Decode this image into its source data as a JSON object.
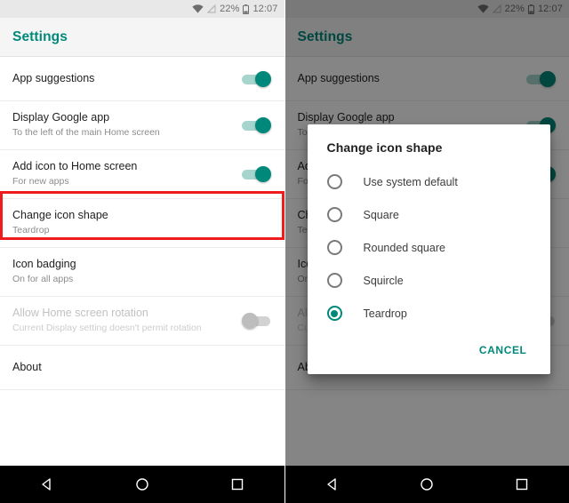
{
  "status_bar": {
    "wifi_icon": "wifi-icon",
    "signal_icon": "signal-off-icon",
    "battery_percent": "22%",
    "battery_icon": "battery-icon",
    "time": "12:07"
  },
  "app_bar": {
    "title": "Settings"
  },
  "colors": {
    "accent": "#00897b",
    "highlight": "#ee1c1c",
    "track_on": "#a6d5ce",
    "track_off": "#d2d2d2"
  },
  "settings_rows": [
    {
      "title": "App suggestions",
      "subtitle": "",
      "control": "toggle",
      "toggle_state": "on",
      "disabled": false,
      "highlighted": false
    },
    {
      "title": "Display Google app",
      "subtitle": "To the left of the main Home screen",
      "control": "toggle",
      "toggle_state": "on",
      "disabled": false,
      "highlighted": false
    },
    {
      "title": "Add icon to Home screen",
      "subtitle": "For new apps",
      "control": "toggle",
      "toggle_state": "on",
      "disabled": false,
      "highlighted": false
    },
    {
      "title": "Change icon shape",
      "subtitle": "Teardrop",
      "control": "none",
      "toggle_state": "",
      "disabled": false,
      "highlighted": true
    },
    {
      "title": "Icon badging",
      "subtitle": "On for all apps",
      "control": "none",
      "toggle_state": "",
      "disabled": false,
      "highlighted": false
    },
    {
      "title": "Allow Home screen rotation",
      "subtitle": "Current Display setting doesn't permit rotation",
      "control": "toggle",
      "toggle_state": "off",
      "disabled": true,
      "highlighted": false
    },
    {
      "title": "About",
      "subtitle": "",
      "control": "none",
      "toggle_state": "",
      "disabled": false,
      "highlighted": false
    }
  ],
  "dialog": {
    "title": "Change icon shape",
    "options": [
      {
        "label": "Use system default",
        "selected": false
      },
      {
        "label": "Square",
        "selected": false
      },
      {
        "label": "Rounded square",
        "selected": false
      },
      {
        "label": "Squircle",
        "selected": false
      },
      {
        "label": "Teardrop",
        "selected": true
      }
    ],
    "cancel_label": "CANCEL"
  },
  "nav_bar": {
    "back_icon": "back-triangle-icon",
    "home_icon": "home-circle-icon",
    "recents_icon": "recents-square-icon"
  }
}
